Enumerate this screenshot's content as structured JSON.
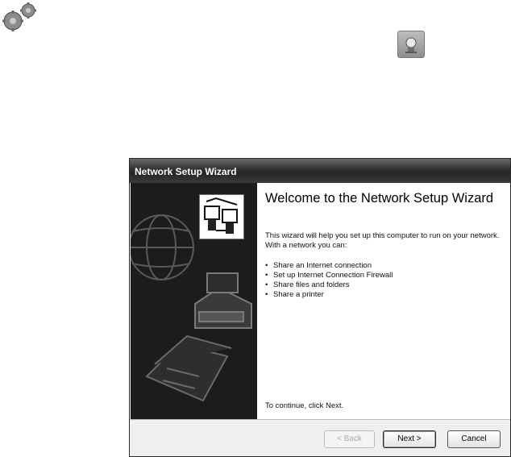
{
  "desktop": {
    "gears_icon": "gears-icon",
    "network_icon": "network-wizard-icon"
  },
  "dialog": {
    "title": "Network Setup Wizard",
    "heading": "Welcome to the Network Setup Wizard",
    "intro": "This wizard will help you set up this computer to run on your network. With a network you can:",
    "bullets": [
      "Share an Internet connection",
      "Set up Internet Connection Firewall",
      "Share files and folders",
      "Share a printer"
    ],
    "continue_text": "To continue, click Next.",
    "buttons": {
      "back": "< Back",
      "next": "Next >",
      "cancel": "Cancel"
    }
  }
}
